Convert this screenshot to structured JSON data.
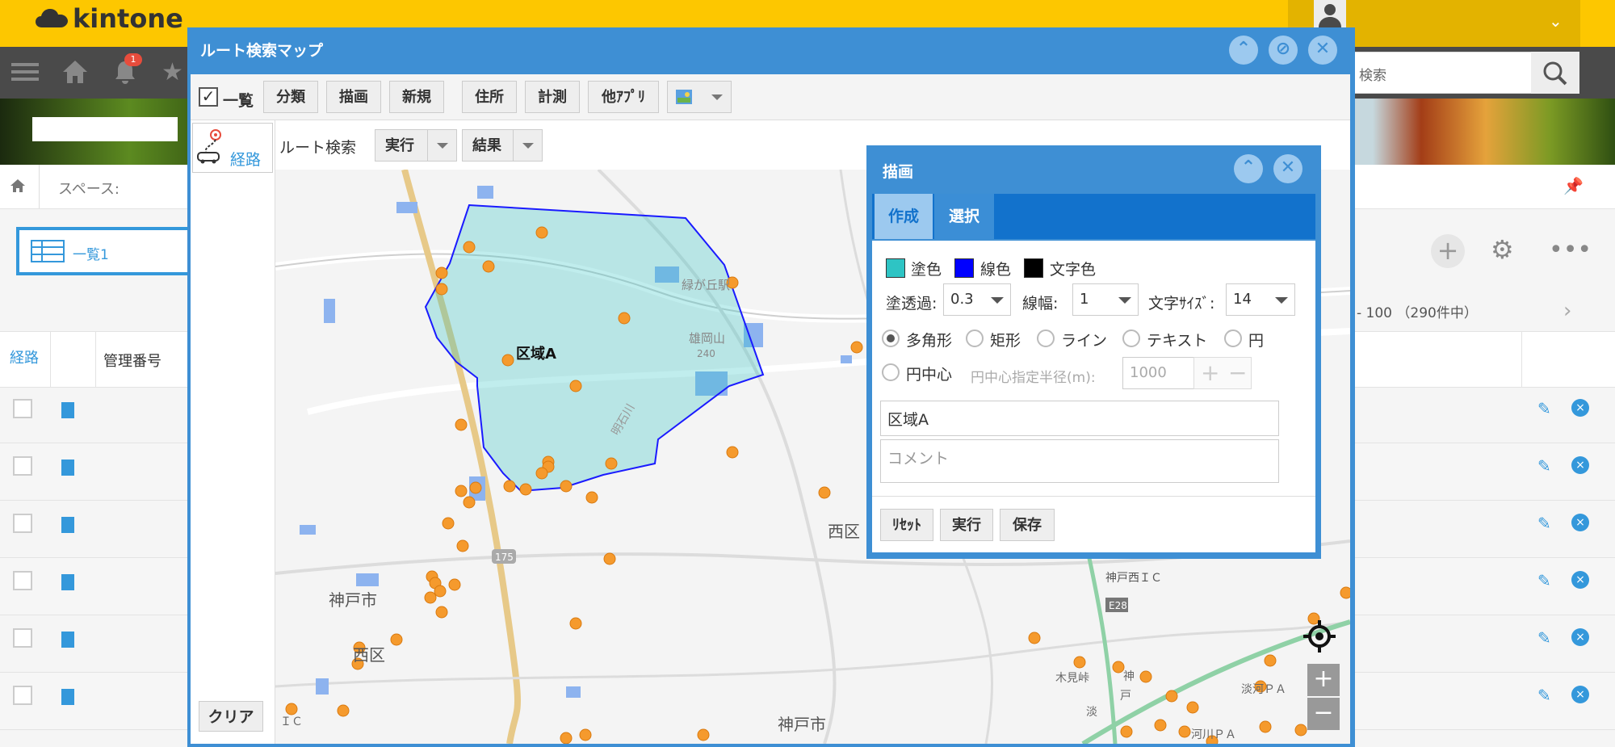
{
  "header": {
    "logo_text": "kintone",
    "notification_count": "1",
    "search_placeholder": "検索"
  },
  "breadcrumb": {
    "space": "スペース:"
  },
  "view": {
    "name": "一覧1",
    "pagination": "- 100 （290件中）"
  },
  "table": {
    "col_route": "経路",
    "col_manage": "管理番号"
  },
  "route_window": {
    "title": "ルート検索マップ",
    "toolbar": {
      "list_check": "一覧",
      "classify": "分類",
      "draw": "描画",
      "new": "新規",
      "address": "住所",
      "measure": "計測",
      "other_app": "他ｱﾌﾟﾘ"
    },
    "side_tab": "経路",
    "search_label": "ルート検索",
    "run": "実行",
    "result": "結果",
    "clear": "クリア"
  },
  "map": {
    "area_label": "区域A",
    "places": [
      "緑が丘駅",
      "雄岡山",
      "明石川",
      "西区",
      "神戸市",
      "西区",
      "神戸市",
      "神戸西ＩＣ",
      "木見峠",
      "E28",
      "175",
      "淡河ＰＡ",
      "ＩＣ",
      "240",
      "神",
      "戸",
      "淡",
      "河川ＰＡ"
    ],
    "fill_color": "#2ec4c4",
    "line_color": "#1a1aff",
    "marker_color": "#f59a2d"
  },
  "draw_dialog": {
    "title": "描画",
    "tab_create": "作成",
    "tab_select": "選択",
    "fill_color_label": "塗色",
    "line_color_label": "線色",
    "text_color_label": "文字色",
    "fill_swatch": "#2ec4c4",
    "line_swatch": "#0000ff",
    "text_swatch": "#000000",
    "opacity_label": "塗透過:",
    "opacity_value": "0.3",
    "linewidth_label": "線幅:",
    "linewidth_value": "1",
    "fontsize_label": "文字ｻｲｽﾞ:",
    "fontsize_value": "14",
    "shapes": [
      "多角形",
      "矩形",
      "ライン",
      "テキスト",
      "円"
    ],
    "circle_center": "円中心",
    "radius_label": "円中心指定半径(m):",
    "radius_value": "1000",
    "name_value": "区域A",
    "comment_placeholder": "コメント",
    "reset": "ﾘｾｯﾄ",
    "run": "実行",
    "save": "保存"
  }
}
